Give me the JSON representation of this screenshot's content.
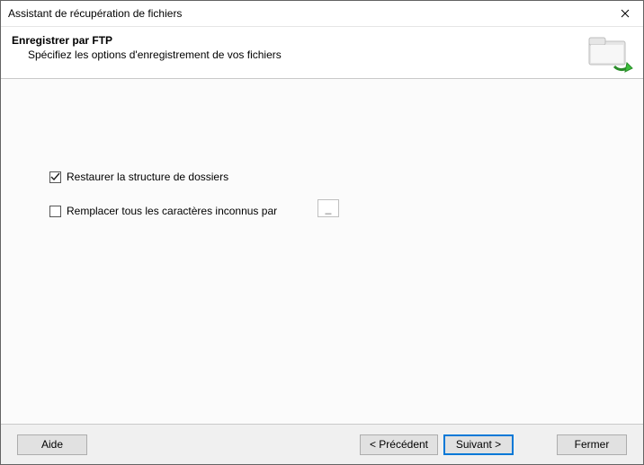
{
  "window": {
    "title": "Assistant de récupération de fichiers",
    "close_icon_name": "close-icon"
  },
  "header": {
    "heading": "Enregistrer par FTP",
    "subheading": "Spécifiez les options d'enregistrement de vos fichiers"
  },
  "options": {
    "restore_structure": {
      "label": "Restaurer la structure de dossiers",
      "checked": true
    },
    "replace_unknown": {
      "label": "Remplacer tous les caractères inconnus par",
      "checked": false,
      "replacement_char": "_"
    }
  },
  "buttons": {
    "help": "Aide",
    "back": "< Précédent",
    "next": "Suivant >",
    "close": "Fermer"
  },
  "colors": {
    "accent": "#0078d7",
    "panel_bg": "#f0f0f0"
  }
}
